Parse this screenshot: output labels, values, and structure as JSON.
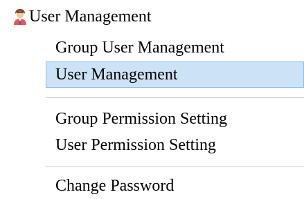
{
  "header": {
    "label": "User Management",
    "icon": "user-icon"
  },
  "menu": {
    "items": [
      {
        "label": "Group User Management",
        "selected": false
      },
      {
        "label": "User Management",
        "selected": true
      },
      {
        "label": "Group Permission Setting",
        "selected": false
      },
      {
        "label": "User Permission Setting",
        "selected": false
      },
      {
        "label": "Change Password",
        "selected": false
      }
    ]
  },
  "colors": {
    "selected_background": "#cce3f7",
    "selected_border": "#8ebbe6",
    "divider": "#c8c8c8"
  }
}
